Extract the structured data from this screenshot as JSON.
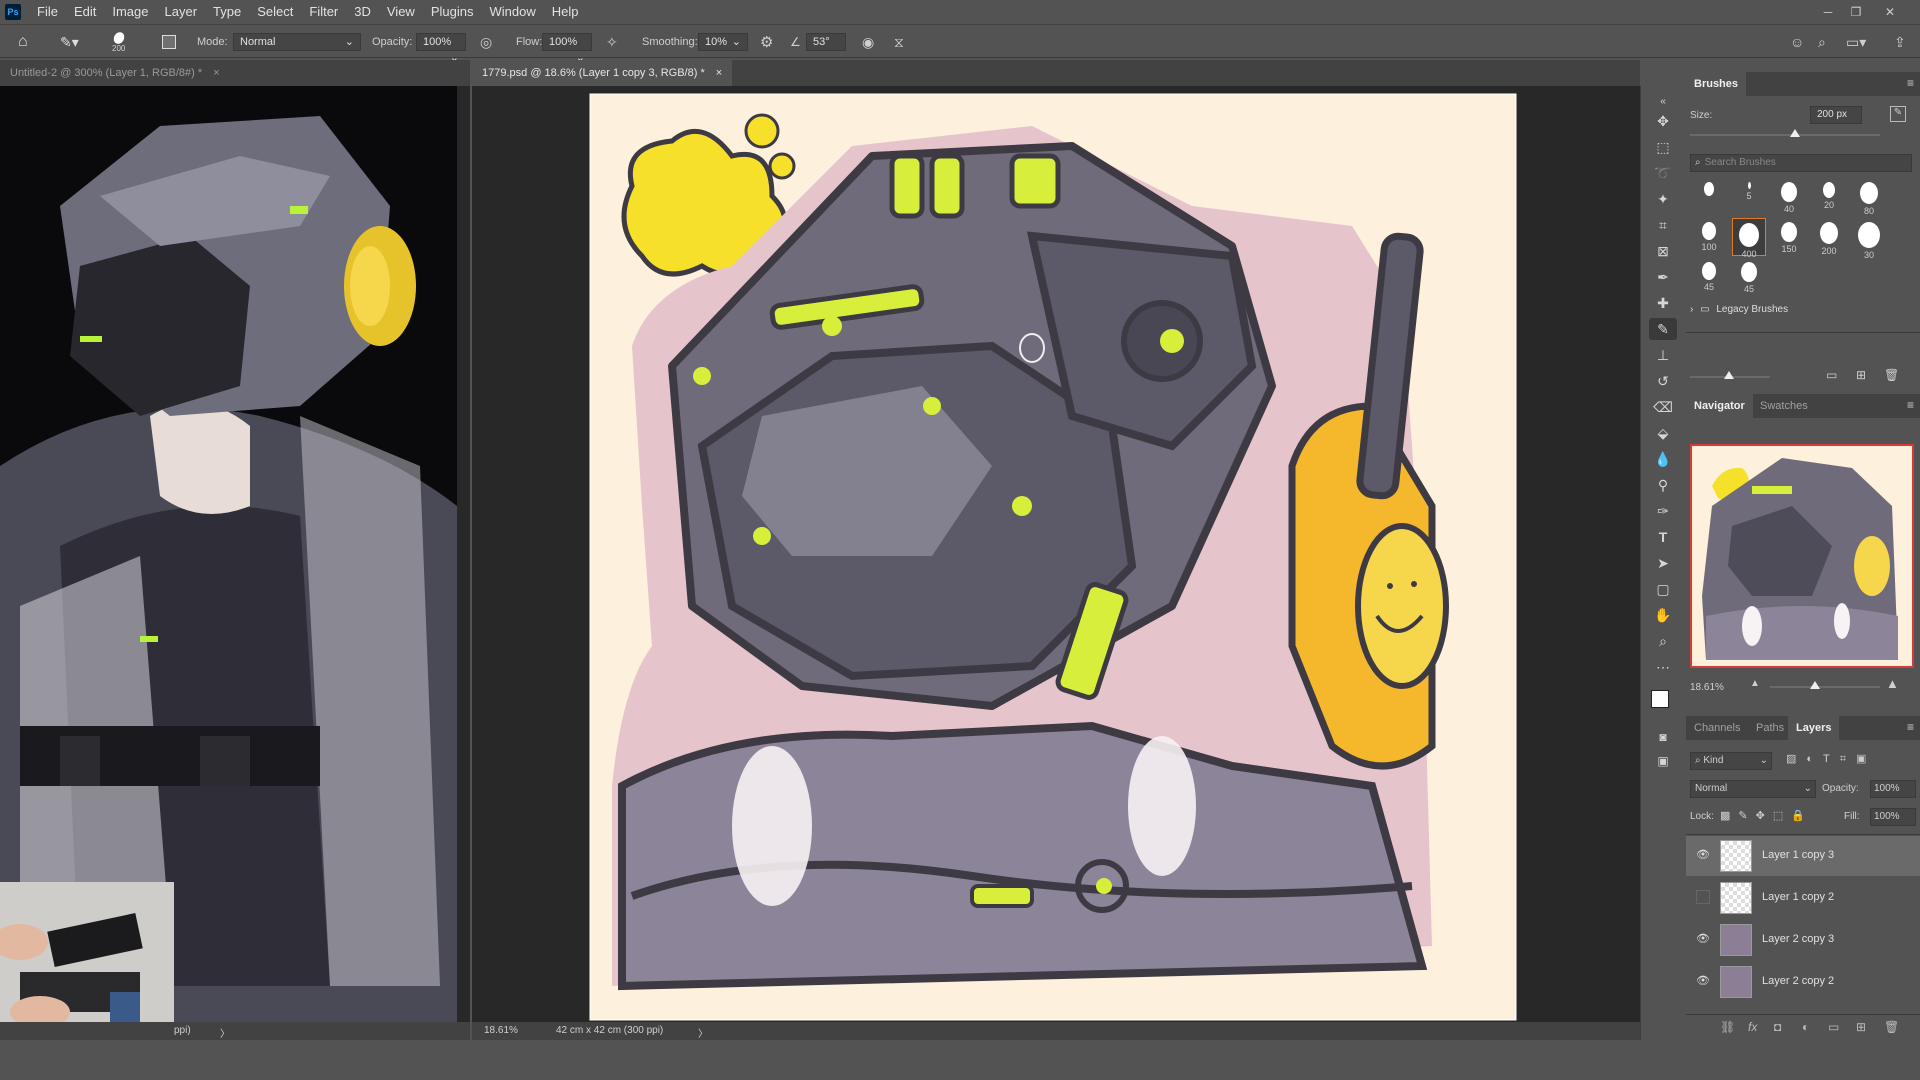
{
  "menu": {
    "items": [
      "File",
      "Edit",
      "Image",
      "Layer",
      "Type",
      "Select",
      "Filter",
      "3D",
      "View",
      "Plugins",
      "Window",
      "Help"
    ]
  },
  "options": {
    "brush_size": "200",
    "mode_label": "Mode:",
    "mode_value": "Normal",
    "opacity_label": "Opacity:",
    "opacity_value": "100%",
    "flow_label": "Flow:",
    "flow_value": "100%",
    "smoothing_label": "Smoothing:",
    "smoothing_value": "10%",
    "angle_value": "53°"
  },
  "tabs": {
    "left_doc": "Untitled-2 @ 300% (Layer 1, RGB/8#) *",
    "right_doc": "1779.psd @ 18.6% (Layer 1 copy 3, RGB/8) *",
    "close": "×"
  },
  "status": {
    "left_zoom": "ppi)",
    "right_zoom": "18.61%",
    "right_dims": "42 cm x 42 cm (300 ppi)",
    "arrow": "〉"
  },
  "brushes": {
    "title": "Brushes",
    "size_label": "Size:",
    "size_value": "200 px",
    "size_fraction": 0.55,
    "search_placeholder": "Search Brushes",
    "tips": [
      {
        "label": "",
        "d": 10
      },
      {
        "label": "5",
        "d": 3
      },
      {
        "label": "40",
        "d": 16
      },
      {
        "label": "20",
        "d": 12
      },
      {
        "label": "80",
        "d": 18
      },
      {
        "label": "100",
        "d": 14
      },
      {
        "label": "400",
        "d": 20
      },
      {
        "label": "150",
        "d": 16
      },
      {
        "label": "200",
        "d": 18
      },
      {
        "label": "30",
        "d": 22
      },
      {
        "label": "45",
        "d": 14
      },
      {
        "label": "45",
        "d": 16
      }
    ],
    "legacy": "Legacy Brushes"
  },
  "navigator": {
    "tab1": "Navigator",
    "tab2": "Swatches",
    "zoom": "18.61%"
  },
  "layers": {
    "tab1": "Channels",
    "tab2": "Paths",
    "tab3": "Layers",
    "kind": "Kind",
    "blend": "Normal",
    "opacity_label": "Opacity:",
    "opacity_value": "100%",
    "lock_label": "Lock:",
    "fill_label": "Fill:",
    "fill_value": "100%",
    "rows": [
      {
        "name": "Layer 1 copy 3",
        "visible": true
      },
      {
        "name": "Layer 1 copy 2",
        "visible": false
      },
      {
        "name": "Layer 2 copy 3",
        "visible": true
      },
      {
        "name": "Layer 2 copy 2",
        "visible": true
      }
    ]
  },
  "colors": {
    "canvas_bg": "#fdf0dc",
    "accent_yellow": "#f7e02a",
    "ink": "#3e3a44"
  }
}
